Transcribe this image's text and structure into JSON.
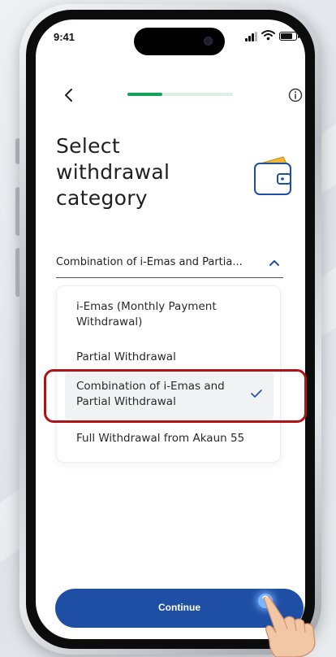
{
  "status_bar": {
    "time": "9:41"
  },
  "onboarding": {
    "progress_fraction": 0.33
  },
  "page": {
    "title_lines": [
      "Select",
      "withdrawal",
      "category"
    ]
  },
  "dropdown": {
    "selected_text": "Combination of i-Emas and Partia...",
    "expanded": true
  },
  "options": [
    {
      "label": "i-Emas (Monthly Payment Withdrawal)",
      "selected": false
    },
    {
      "label": "Partial Withdrawal",
      "selected": false
    },
    {
      "label": "Combination of i-Emas and Partial Withdrawal",
      "selected": true
    },
    {
      "label": "Full Withdrawal from Akaun 55",
      "selected": false
    }
  ],
  "continue_label": "Continue",
  "colors": {
    "accent_green": "#13a35a",
    "primary_blue": "#1f4fa5",
    "highlight_red": "#b01317"
  },
  "icons": [
    "back-chevron-icon",
    "info-icon",
    "wallet-icon",
    "chevron-up-icon",
    "checkmark-icon",
    "signal-icon",
    "wifi-icon",
    "battery-icon",
    "pointing-hand-icon"
  ]
}
